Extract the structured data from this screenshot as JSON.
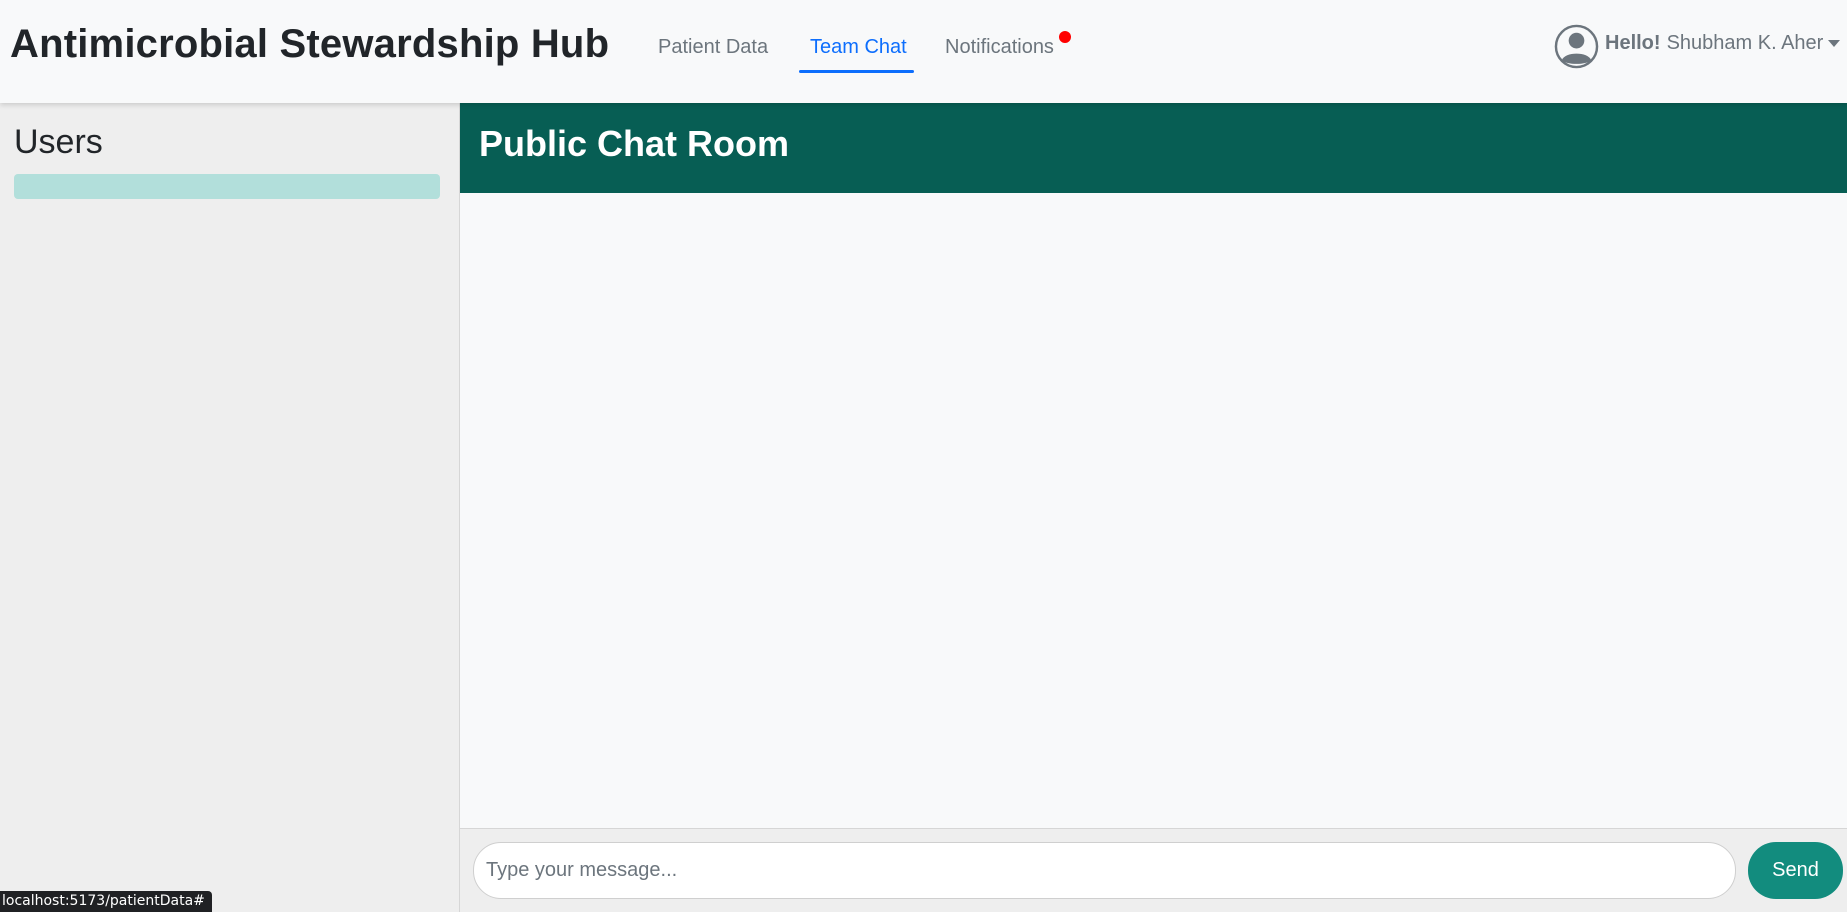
{
  "app": {
    "brand": "Antimicrobial Stewardship Hub"
  },
  "nav": {
    "items": [
      {
        "label": "Patient Data",
        "active": false
      },
      {
        "label": "Team Chat",
        "active": true
      },
      {
        "label": "Notifications",
        "active": false,
        "has_unread_dot": true
      }
    ]
  },
  "user_menu": {
    "greeting": "Hello!",
    "username": "Shubham K. Aher",
    "avatar_icon": "user-circle-icon",
    "caret_icon": "caret-down-icon"
  },
  "sidebar": {
    "title": "Users",
    "items": [
      {
        "label": ""
      }
    ]
  },
  "chat": {
    "room_title": "Public Chat Room",
    "messages": [],
    "input": {
      "value": "",
      "placeholder": "Type your message..."
    },
    "send_label": "Send"
  },
  "status_bar": {
    "url": "localhost:5173/patientData#"
  },
  "colors": {
    "header_green": "#075e54",
    "send_green": "#128c7e",
    "active_link": "#0d6efd",
    "user_item": "#b2dfdb",
    "notification_dot": "#ff0000"
  }
}
